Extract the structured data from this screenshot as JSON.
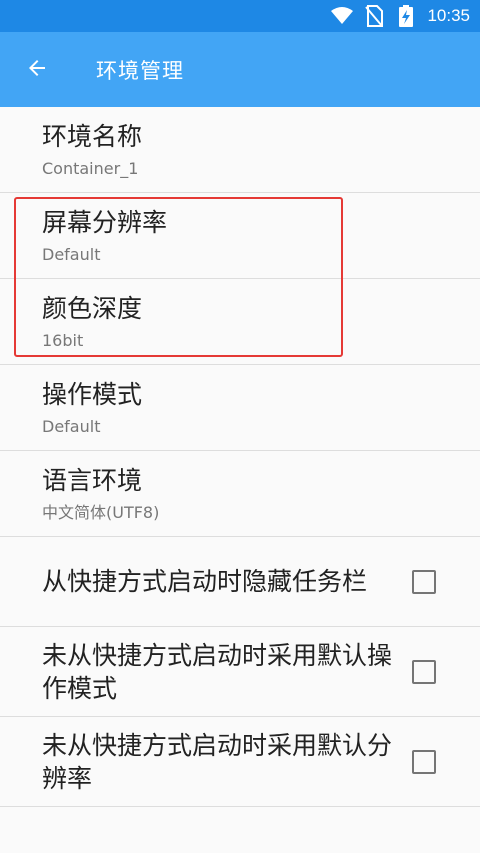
{
  "status_bar": {
    "time": "10:35",
    "icons": [
      "wifi-icon",
      "no-sim-icon",
      "battery-charging-icon"
    ],
    "bg_color": "#1e88e5"
  },
  "app_bar": {
    "title": "环境管理",
    "back_icon": "arrow-back-icon",
    "bg_color": "#42a5f5"
  },
  "settings": {
    "items": [
      {
        "title": "环境名称",
        "summary": "Container_1"
      },
      {
        "title": "屏幕分辨率",
        "summary": "Default"
      },
      {
        "title": "颜色深度",
        "summary": "16bit"
      },
      {
        "title": "操作模式",
        "summary": "Default"
      },
      {
        "title": "语言环境",
        "summary": "中文简体(UTF8)"
      }
    ],
    "checkbox_items": [
      {
        "title": "从快捷方式启动时隐藏任务栏",
        "checked": false
      },
      {
        "title": "未从快捷方式启动时采用默认操作模式",
        "checked": false
      },
      {
        "title": "未从快捷方式启动时采用默认分辨率",
        "checked": false
      }
    ]
  },
  "highlight_color": "#e53935"
}
